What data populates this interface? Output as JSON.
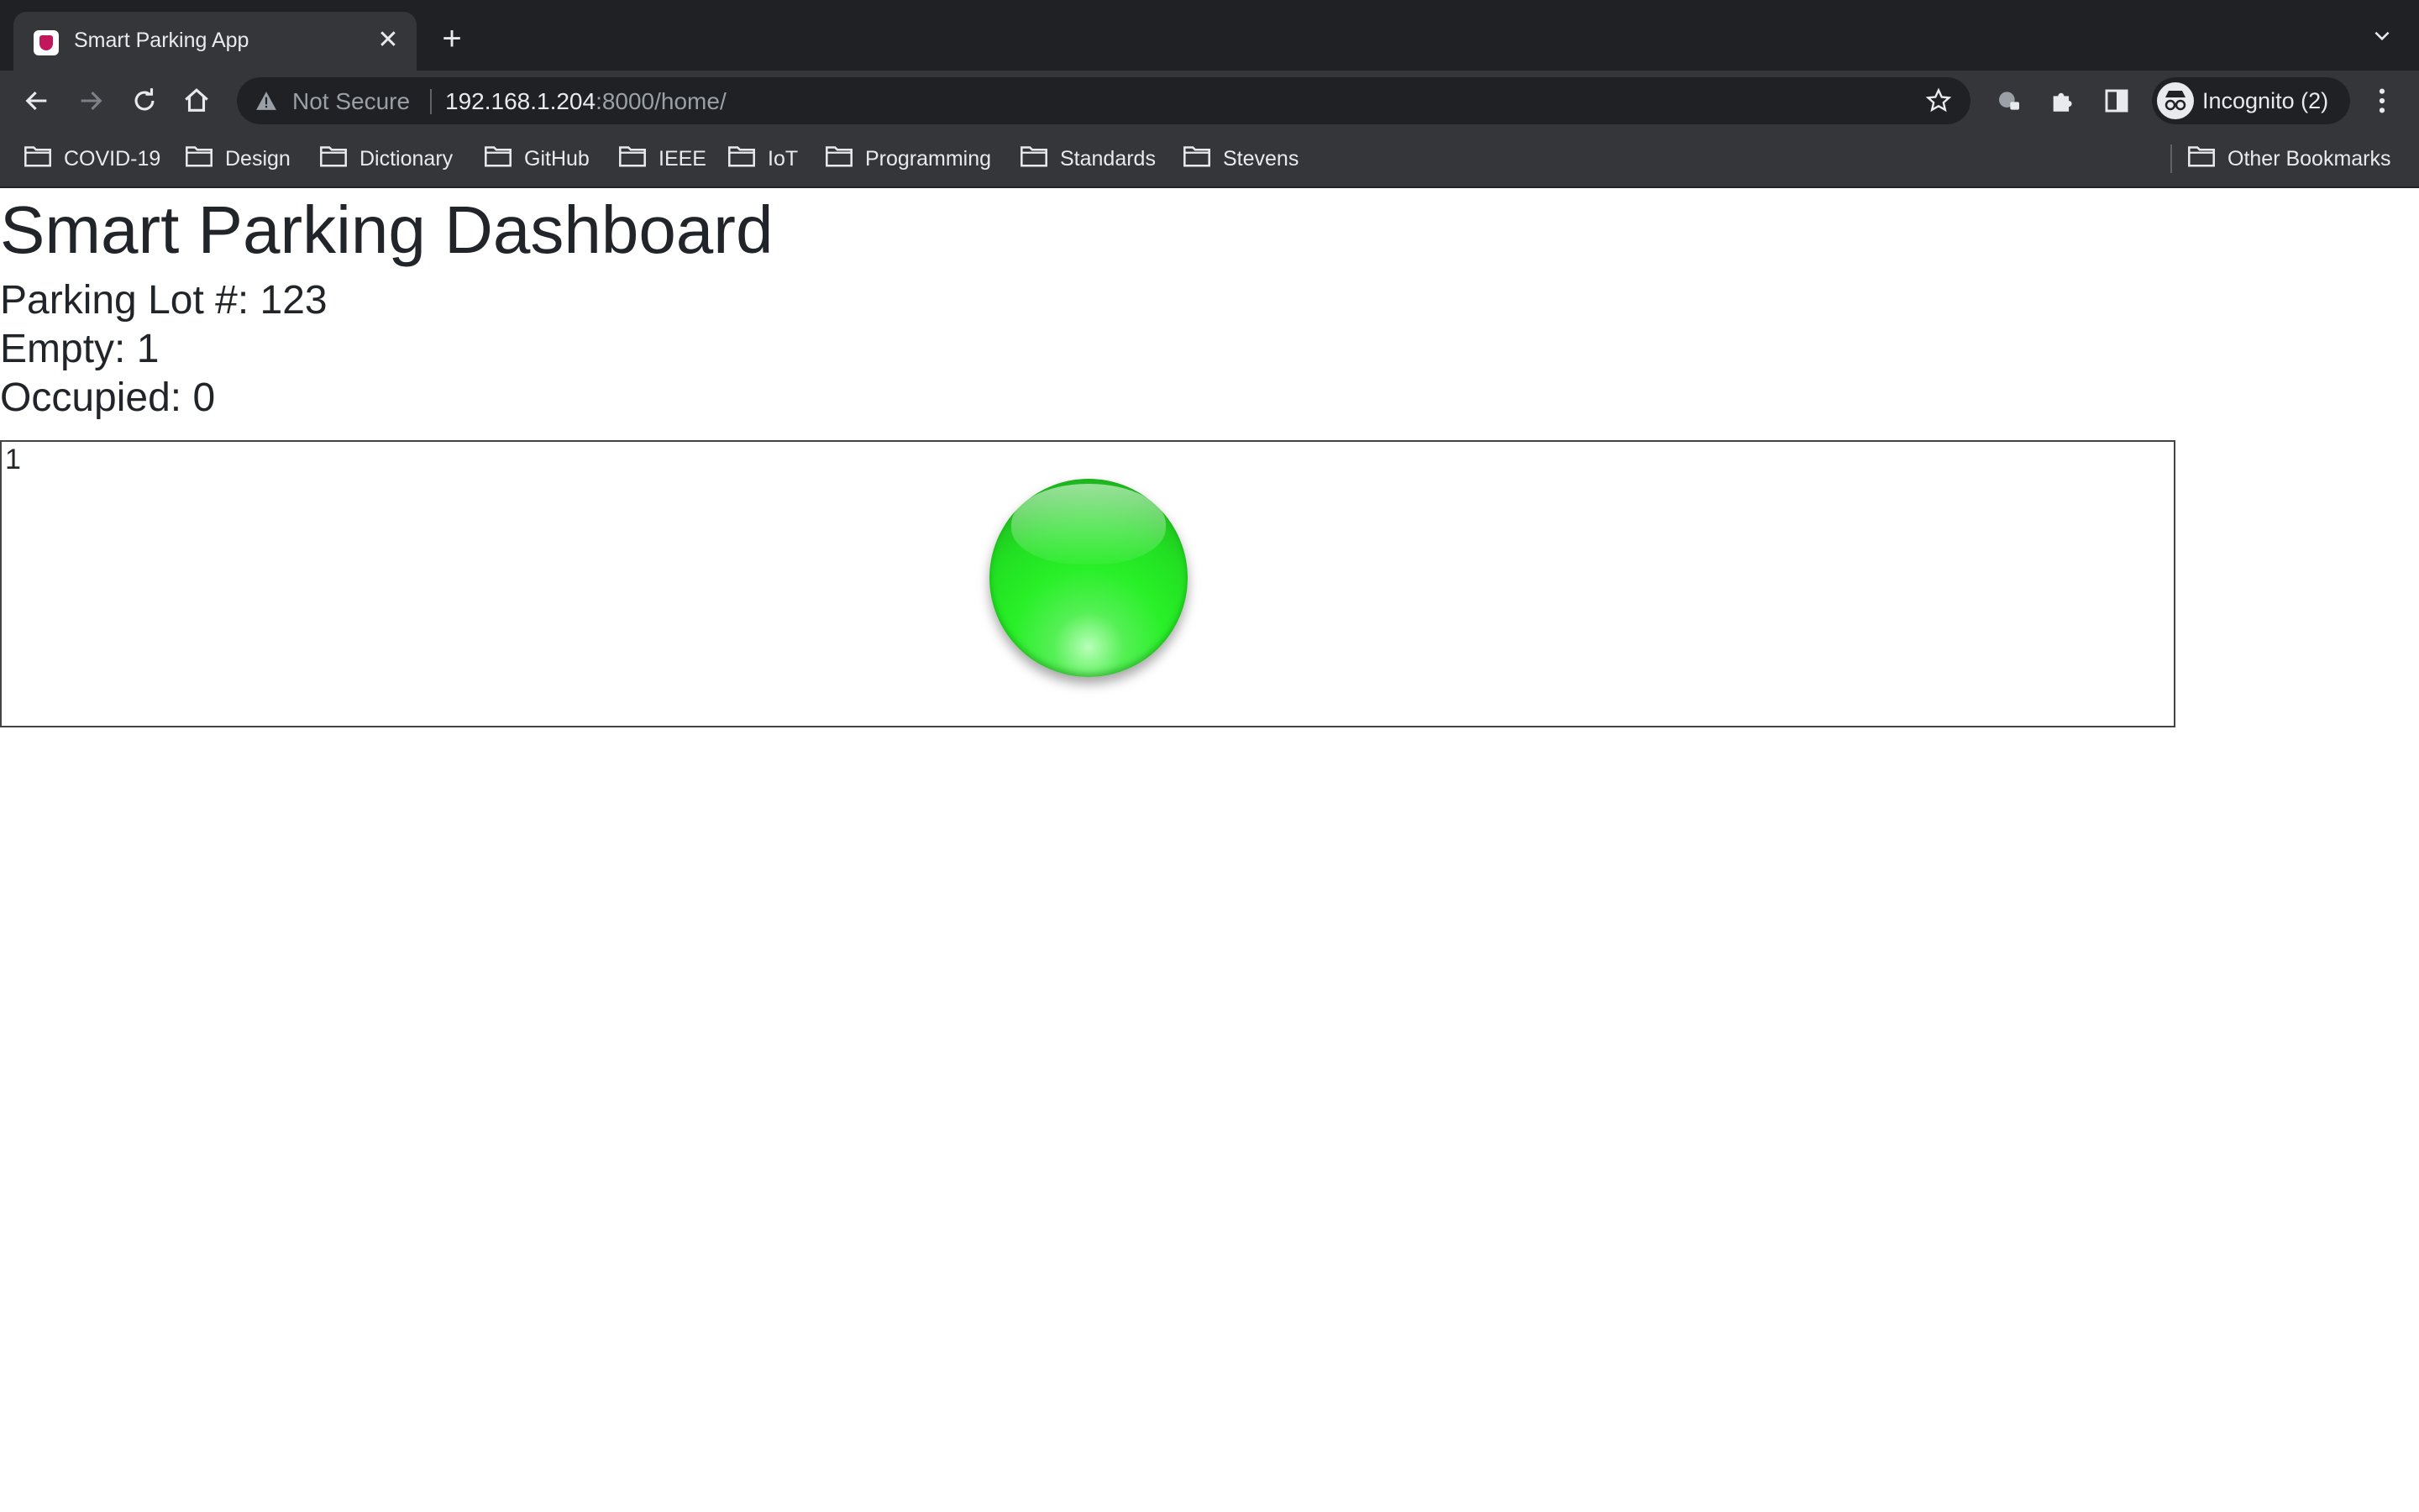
{
  "browser": {
    "tab_title": "Smart Parking App",
    "url_warning": "Not Secure",
    "url_host": "192.168.1.204",
    "url_path": ":8000/home/",
    "profile_label": "Incognito (2)",
    "bookmarks": [
      "COVID-19",
      "Design",
      "Dictionary",
      "GitHub",
      "IEEE",
      "IoT",
      "Programming",
      "Standards",
      "Stevens"
    ],
    "other_bookmarks": "Other Bookmarks"
  },
  "page": {
    "title": "Smart Parking Dashboard",
    "lot_label": "Parking Lot #: 123",
    "empty_label": "Empty: 1",
    "occupied_label": "Occupied: 0"
  },
  "spots": [
    {
      "number": "1",
      "status": "empty",
      "color": "#22f022"
    }
  ]
}
